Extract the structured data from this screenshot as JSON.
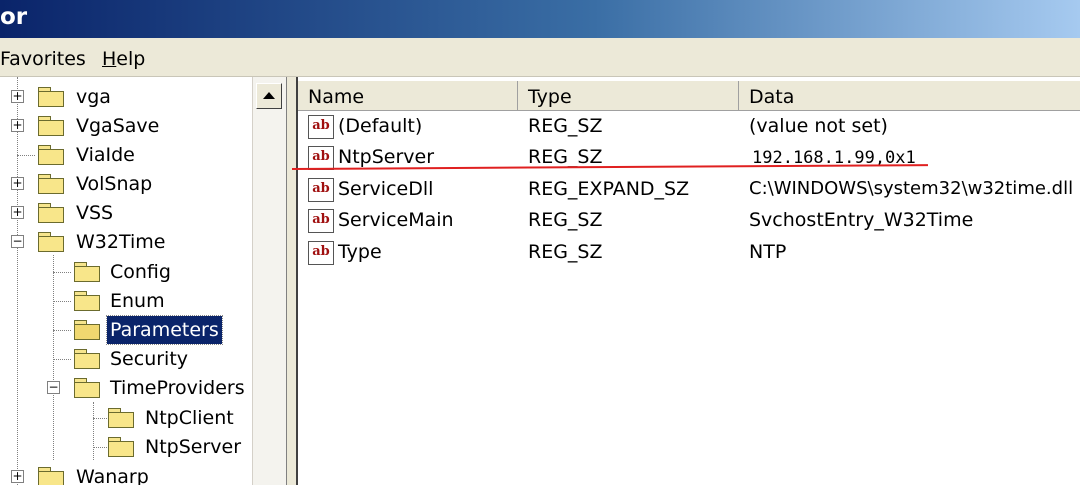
{
  "window": {
    "title_fragment": "or"
  },
  "menu": [
    {
      "label": "Favorites"
    },
    {
      "label": "Help",
      "underline": "H",
      "rest": "elp"
    }
  ],
  "tree": [
    {
      "label": "vga"
    },
    {
      "label": "VgaSave"
    },
    {
      "label": "ViaIde"
    },
    {
      "label": "VolSnap"
    },
    {
      "label": "VSS"
    },
    {
      "label": "W32Time"
    },
    {
      "label": "Config"
    },
    {
      "label": "Enum"
    },
    {
      "label": "Parameters"
    },
    {
      "label": "Security"
    },
    {
      "label": "TimeProviders"
    },
    {
      "label": "NtpClient"
    },
    {
      "label": "NtpServer"
    },
    {
      "label": "Wanarp"
    }
  ],
  "list": {
    "columns": [
      "Name",
      "Type",
      "Data"
    ],
    "rows": [
      {
        "name": "(Default)",
        "type": "REG_SZ",
        "data": "(value not set)"
      },
      {
        "name": "NtpServer",
        "type": "REG_SZ",
        "data": "192.168.1.99,0x1"
      },
      {
        "name": "ServiceDll",
        "type": "REG_EXPAND_SZ",
        "data": "C:\\WINDOWS\\system32\\w32time.dll"
      },
      {
        "name": "ServiceMain",
        "type": "REG_SZ",
        "data": "SvchostEntry_W32Time"
      },
      {
        "name": "Type",
        "type": "REG_SZ",
        "data": "NTP"
      }
    ]
  },
  "icons": {
    "value_icon_text": "ab"
  },
  "colors": {
    "selection": "#0a246a",
    "annotation": "#e02020",
    "folder": "#f8e68a"
  }
}
